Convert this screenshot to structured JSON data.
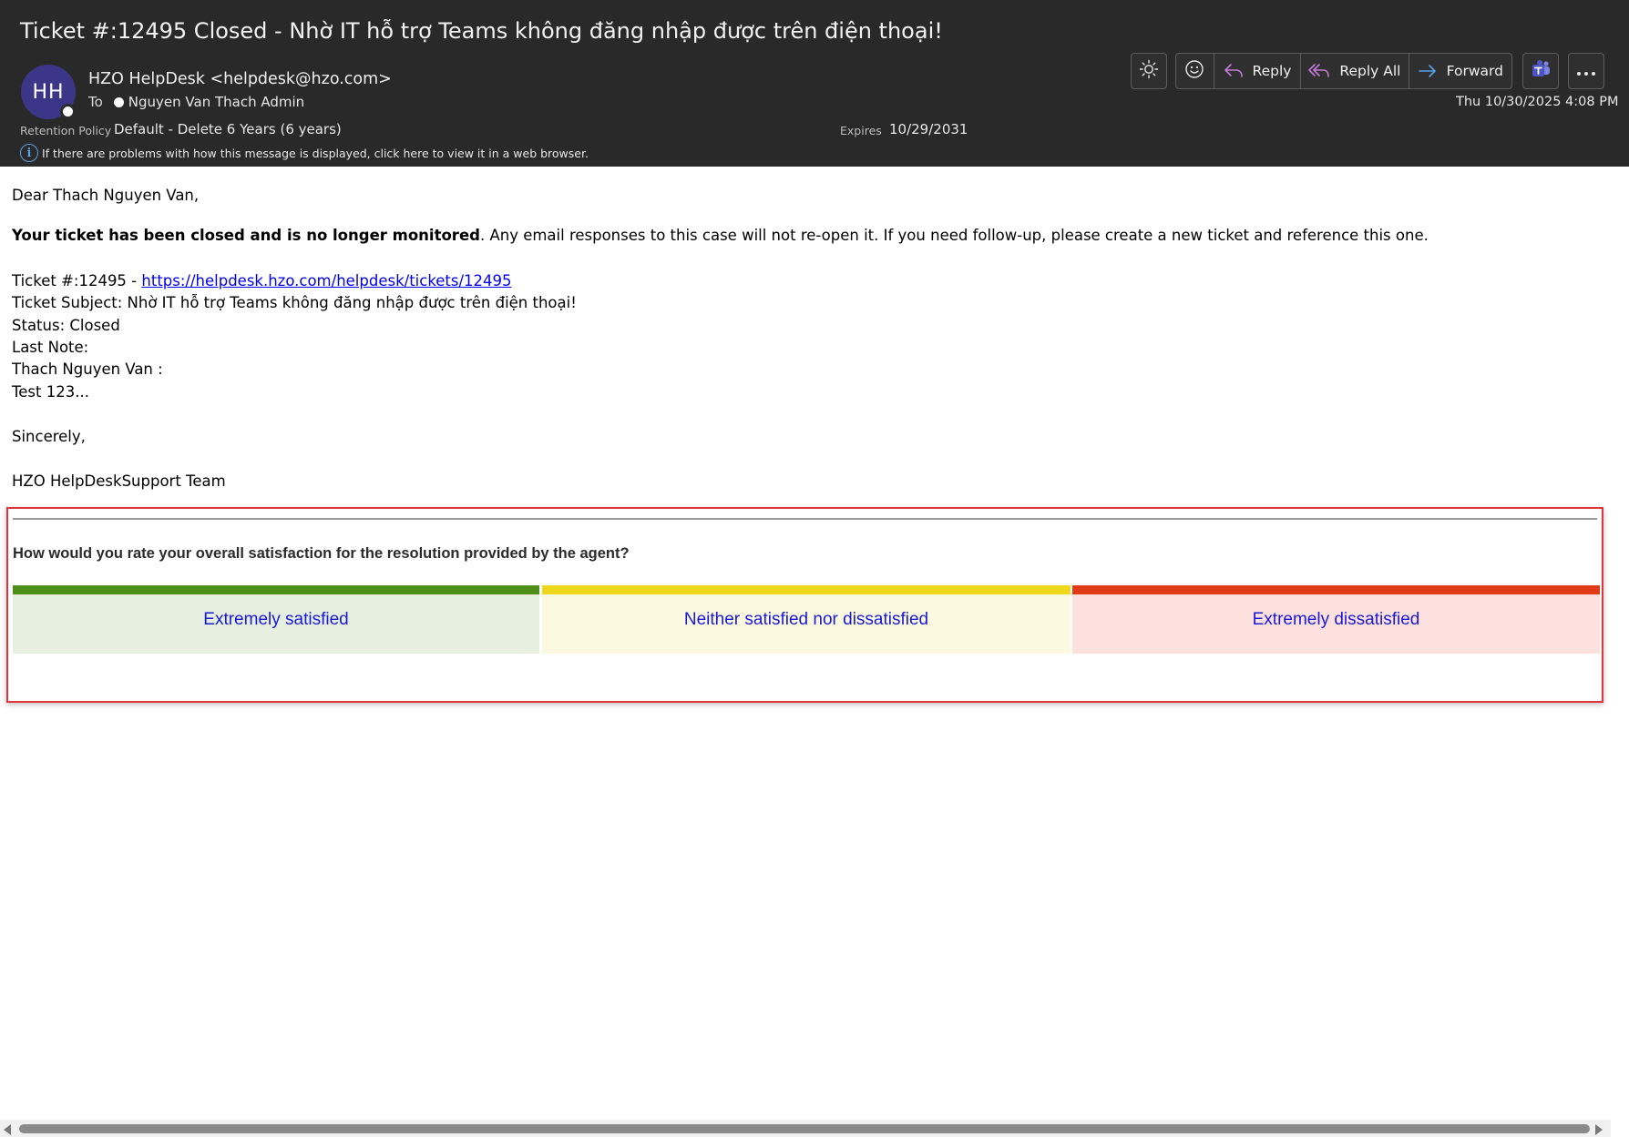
{
  "header": {
    "subject": "Ticket #:12495 Closed - Nhờ IT hỗ trợ Teams không đăng nhập được trên điện thoại!",
    "avatar_initials": "HH",
    "sender": "HZO HelpDesk <helpdesk@hzo.com>",
    "to_label": "To",
    "to_name": "Nguyen Van Thach Admin",
    "retention_label": "Retention Policy",
    "retention_value": "Default - Delete 6 Years (6 years)",
    "expires_label": "Expires",
    "expires_value": "10/29/2031",
    "info_text": "If there are problems with how this message is displayed, click here to view it in a web browser.",
    "datetime": "Thu 10/30/2025 4:08 PM",
    "avatar_color": "#3c3689"
  },
  "toolbar": {
    "brightness_icon": "sun-icon",
    "emoji_icon": "smiley-icon",
    "reply_label": "Reply",
    "reply_all_label": "Reply All",
    "forward_label": "Forward",
    "teams_icon": "teams-icon",
    "more_icon": "more-icon",
    "reply_icon_color": "#c37ad8",
    "forward_icon_color": "#5aa0e6"
  },
  "message": {
    "greeting": "Dear Thach Nguyen Van,",
    "closed_bold": "Your ticket has been closed and is no longer monitored",
    "closed_rest": ". Any email responses to this case will not re-open it. If you need follow-up, please create a new ticket and reference this one.",
    "ticket_prefix": "Ticket #:12495 - ",
    "ticket_link": "https://helpdesk.hzo.com/helpdesk/tickets/12495",
    "ticket_subject": "Ticket Subject: Nhờ IT hỗ trợ Teams không đăng nhập được trên điện thoại!",
    "status": "Status: Closed",
    "last_note": "Last Note:",
    "note_author": "Thach Nguyen Van :",
    "note_text": "Test 123...",
    "sign_off": "Sincerely,",
    "team": "HZO HelpDeskSupport Team"
  },
  "survey": {
    "question": "How would you rate your overall satisfaction for the resolution provided by the agent?",
    "options": [
      {
        "label": "Extremely satisfied",
        "bar_color": "#4e8f1a",
        "bg_color": "#e6efe0"
      },
      {
        "label": "Neither satisfied nor dissatisfied",
        "bar_color": "#efd81c",
        "bg_color": "#fbf9e0"
      },
      {
        "label": "Extremely dissatisfied",
        "bar_color": "#e03a16",
        "bg_color": "#fde1df"
      }
    ],
    "highlight_color": "#e0353b"
  }
}
